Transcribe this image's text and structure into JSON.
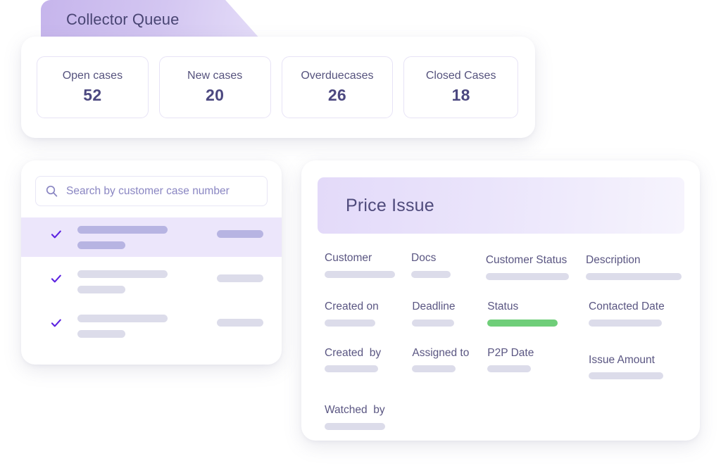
{
  "tab": {
    "label": "Collector Queue"
  },
  "stats": {
    "cards": [
      {
        "label": "Open cases",
        "value": "52"
      },
      {
        "label": "New cases",
        "value": "20"
      },
      {
        "label": "Overduecases",
        "value": "26"
      },
      {
        "label": "Closed Cases",
        "value": "18"
      }
    ]
  },
  "search": {
    "placeholder": "Search by customer case number",
    "value": "",
    "icon": "search-icon"
  },
  "case_list": {
    "rows": [
      {
        "selected": true,
        "check_icon": "check-icon"
      },
      {
        "selected": false,
        "check_icon": "check-icon"
      },
      {
        "selected": false,
        "check_icon": "check-icon"
      }
    ]
  },
  "detail": {
    "title": "Price Issue",
    "rows": [
      [
        {
          "label": "Customer",
          "bar": 100,
          "col": 128,
          "status": "placeholder"
        },
        {
          "label": "Docs",
          "bar": 56,
          "col": 110,
          "status": "placeholder"
        },
        {
          "label": "Customer Status",
          "bar": 118,
          "col": 148,
          "status": "placeholder"
        },
        {
          "label": "Description",
          "bar": 136,
          "col": 140,
          "status": "placeholder"
        }
      ],
      [
        {
          "label": "Created on",
          "bar": 72,
          "col": 128,
          "status": "placeholder"
        },
        {
          "label": "Deadline",
          "bar": 60,
          "col": 110,
          "status": "placeholder"
        },
        {
          "label": "Status",
          "bar": 100,
          "col": 148,
          "status": "active"
        },
        {
          "label": "Contacted Date",
          "bar": 104,
          "col": 140,
          "status": "placeholder"
        }
      ],
      [
        {
          "label": "Created  by",
          "bar": 76,
          "col": 128,
          "status": "placeholder"
        },
        {
          "label": "Assigned to",
          "bar": 62,
          "col": 110,
          "status": "placeholder"
        },
        {
          "label": "P2P Date",
          "bar": 62,
          "col": 148,
          "status": "placeholder"
        },
        {
          "label": "Issue Amount",
          "bar": 106,
          "col": 140,
          "status": "placeholder"
        }
      ],
      [
        {
          "label": "Watched  by",
          "bar": 86,
          "col": 128,
          "status": "placeholder"
        }
      ]
    ]
  },
  "colors": {
    "accent": "#6c4fd8",
    "tab_fill": "#c6b5ec",
    "heading_text": "#4f4b7c",
    "skeleton": "#dcdcea",
    "skeleton_selected": "#b7b4e2",
    "status_green": "#6fce79",
    "selected_row_bg": "#ece6fb",
    "page_bg": "#ffffff"
  }
}
